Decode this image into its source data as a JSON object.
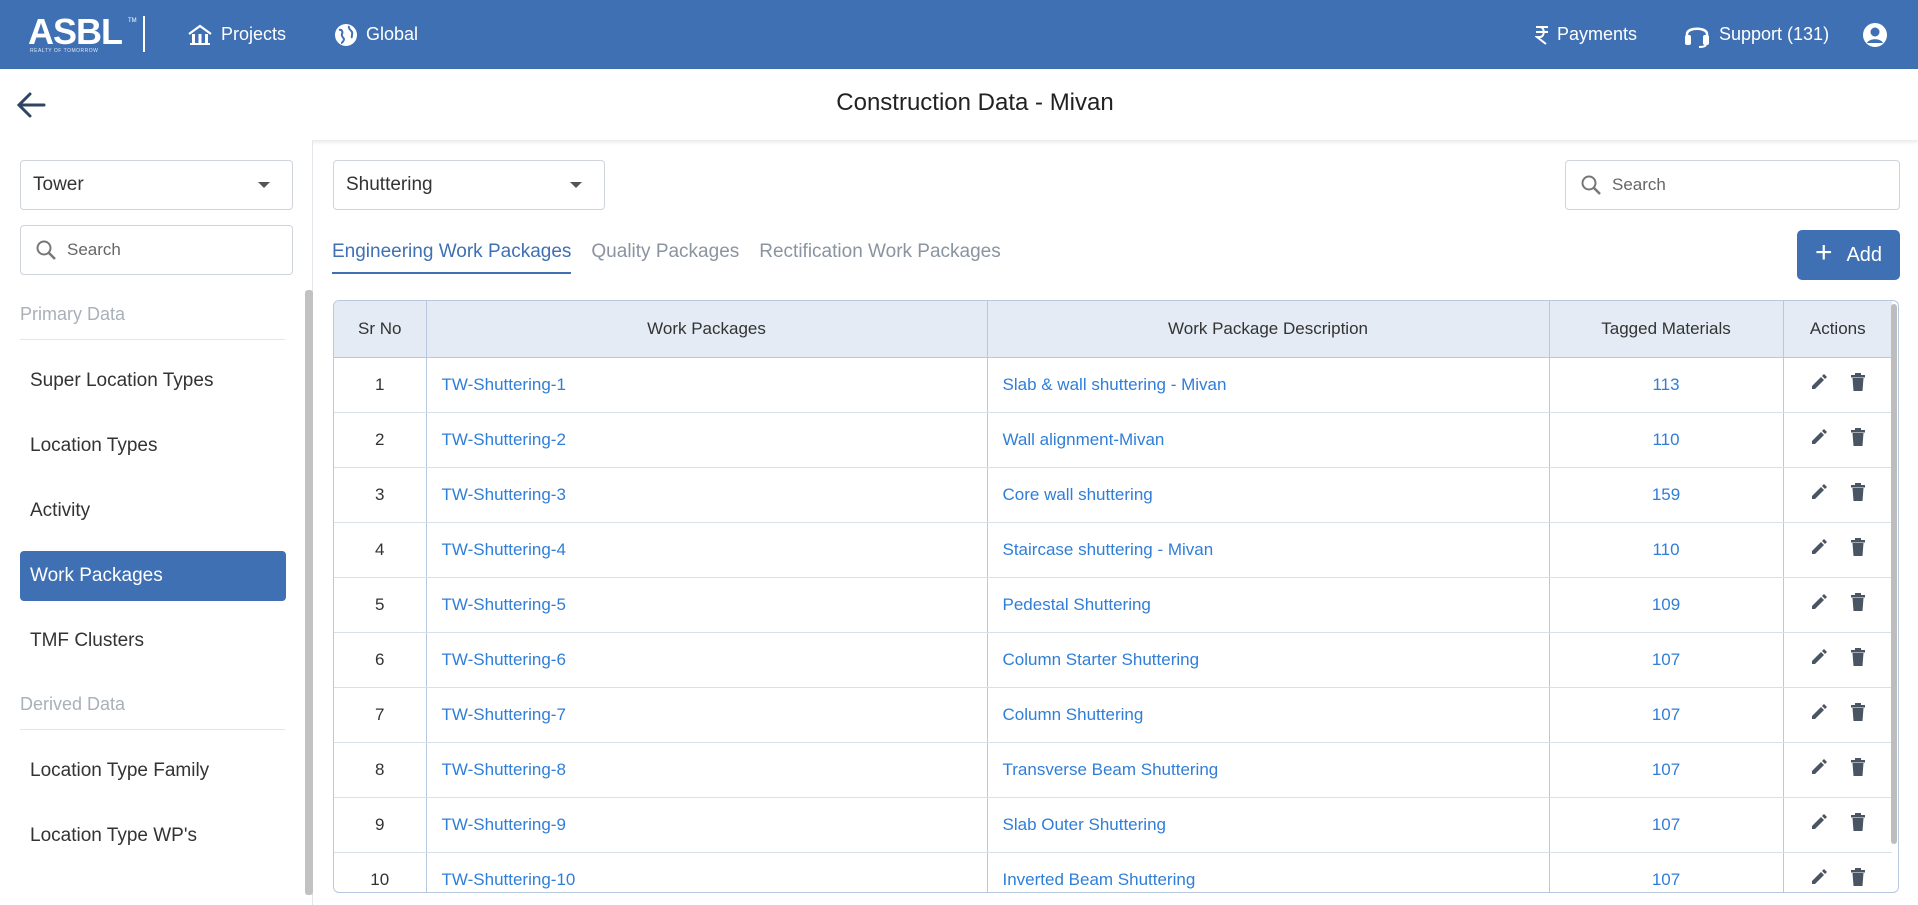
{
  "brand": {
    "logo_text": "ASBL",
    "logo_tagline": "REALTY OF TOMORROW",
    "trademark": "TM"
  },
  "topnav": {
    "projects_label": "Projects",
    "global_label": "Global",
    "payments_label": "Payments",
    "support_label": "Support (131)"
  },
  "page": {
    "title": "Construction Data - Mivan"
  },
  "sidebar": {
    "dropdown_value": "Tower",
    "search_placeholder": "Search",
    "primary_section": "Primary Data",
    "primary_items": [
      "Super Location Types",
      "Location Types",
      "Activity",
      "Work Packages",
      "TMF Clusters"
    ],
    "active_item": "Work Packages",
    "derived_section": "Derived Data",
    "derived_items": [
      "Location Type Family",
      "Location Type WP's"
    ]
  },
  "main": {
    "category_value": "Shuttering",
    "search_placeholder": "Search",
    "tabs": [
      "Engineering Work Packages",
      "Quality Packages",
      "Rectification Work Packages"
    ],
    "active_tab": "Engineering Work Packages",
    "add_label": "Add"
  },
  "table": {
    "headers": [
      "Sr No",
      "Work Packages",
      "Work Package Description",
      "Tagged Materials",
      "Actions"
    ],
    "rows": [
      {
        "sr": "1",
        "wp": "TW-Shuttering-1",
        "desc": "Slab & wall shuttering - Mivan",
        "tagged": "113"
      },
      {
        "sr": "2",
        "wp": "TW-Shuttering-2",
        "desc": "Wall alignment-Mivan",
        "tagged": "110"
      },
      {
        "sr": "3",
        "wp": "TW-Shuttering-3",
        "desc": "Core wall shuttering",
        "tagged": "159"
      },
      {
        "sr": "4",
        "wp": "TW-Shuttering-4",
        "desc": "Staircase shuttering - Mivan",
        "tagged": "110"
      },
      {
        "sr": "5",
        "wp": "TW-Shuttering-5",
        "desc": "Pedestal Shuttering",
        "tagged": "109"
      },
      {
        "sr": "6",
        "wp": "TW-Shuttering-6",
        "desc": "Column Starter Shuttering",
        "tagged": "107"
      },
      {
        "sr": "7",
        "wp": "TW-Shuttering-7",
        "desc": "Column Shuttering",
        "tagged": "107"
      },
      {
        "sr": "8",
        "wp": "TW-Shuttering-8",
        "desc": "Transverse Beam Shuttering",
        "tagged": "107"
      },
      {
        "sr": "9",
        "wp": "TW-Shuttering-9",
        "desc": "Slab Outer Shuttering",
        "tagged": "107"
      },
      {
        "sr": "10",
        "wp": "TW-Shuttering-10",
        "desc": "Inverted Beam Shuttering",
        "tagged": "107"
      }
    ]
  },
  "icons": {
    "projects": "building-icon",
    "global": "globe-icon",
    "payments": "rupee-icon",
    "support": "headset-icon",
    "account": "user-circle-icon",
    "back": "arrow-left-icon",
    "search": "search-icon",
    "edit": "pencil-icon",
    "delete": "trash-icon"
  },
  "colors": {
    "primary": "#3f70b3",
    "link": "#2f7ed8",
    "header_bg": "#e4ebf5",
    "muted": "#a9b0b8"
  }
}
